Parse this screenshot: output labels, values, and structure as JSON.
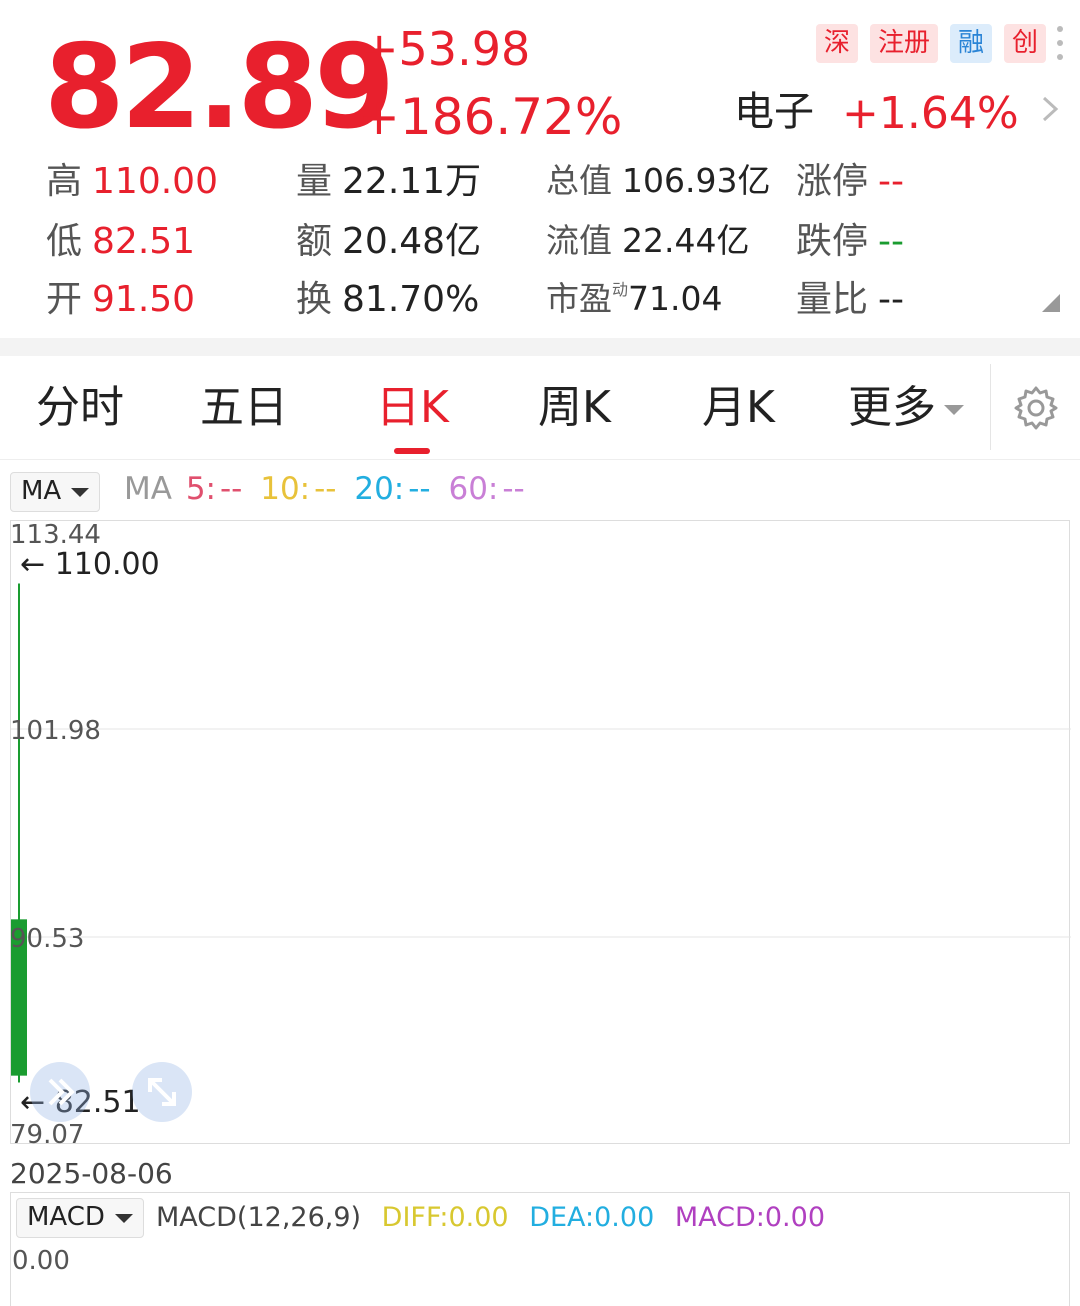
{
  "quote": {
    "price": "82.89",
    "change": "+53.98",
    "change_pct": "+186.72%",
    "sector_name": "电子",
    "sector_change": "+1.64%",
    "badges": [
      {
        "label": "深",
        "color": "#e8202d"
      },
      {
        "label": "注册",
        "color": "#e8202d"
      },
      {
        "label": "融",
        "color": "#2a84d6"
      },
      {
        "label": "创",
        "color": "#e8202d"
      }
    ]
  },
  "stats": {
    "high": {
      "label": "高",
      "value": "110.00"
    },
    "low": {
      "label": "低",
      "value": "82.51"
    },
    "open": {
      "label": "开",
      "value": "91.50"
    },
    "volume": {
      "label": "量",
      "value": "22.11万"
    },
    "amount": {
      "label": "额",
      "value": "20.48亿"
    },
    "turnover": {
      "label": "换",
      "value": "81.70%"
    },
    "total_cap": {
      "label": "总值",
      "value": "106.93亿"
    },
    "float_cap": {
      "label": "流值",
      "value": "22.44亿"
    },
    "pe": {
      "label": "市盈",
      "sup": "动",
      "value": "71.04"
    },
    "limit_up": {
      "label": "涨停",
      "value": "--"
    },
    "limit_down": {
      "label": "跌停",
      "value": "--"
    },
    "volume_ratio": {
      "label": "量比",
      "value": "--"
    }
  },
  "tabs": {
    "items": [
      "分时",
      "五日",
      "日K",
      "周K",
      "月K",
      "更多"
    ],
    "active": "日K"
  },
  "indicators": {
    "main_selector": "MA",
    "ma_title": "MA",
    "ma5": {
      "label": "5:",
      "value": "--",
      "color": "#e0506e"
    },
    "ma10": {
      "label": "10:",
      "value": "--",
      "color": "#e8c23a"
    },
    "ma20": {
      "label": "20:",
      "value": "--",
      "color": "#22aee0"
    },
    "ma60": {
      "label": "60:",
      "value": "--",
      "color": "#c97fd6"
    },
    "sub_selector": "MACD",
    "macd_title": "MACD(12,26,9)",
    "diff": "DIFF:0.00",
    "dea": "DEA:0.00",
    "macd": "MACD:0.00",
    "diff_color": "#d8c830",
    "dea_color": "#22aee0",
    "macd_color": "#b040c0",
    "macd_axis": "0.00"
  },
  "chart_data": {
    "type": "candlestick",
    "date_label": "2025-08-06",
    "y_ticks": [
      "113.44",
      "101.98",
      "90.53",
      "79.07"
    ],
    "ylim": [
      79.07,
      113.44
    ],
    "high_marker": "110.00",
    "low_marker": "82.51",
    "candles": [
      {
        "date": "2025-08-06",
        "open": 91.5,
        "high": 110.0,
        "low": 82.51,
        "close": 82.89
      }
    ],
    "down_color": "#1a9c30"
  }
}
